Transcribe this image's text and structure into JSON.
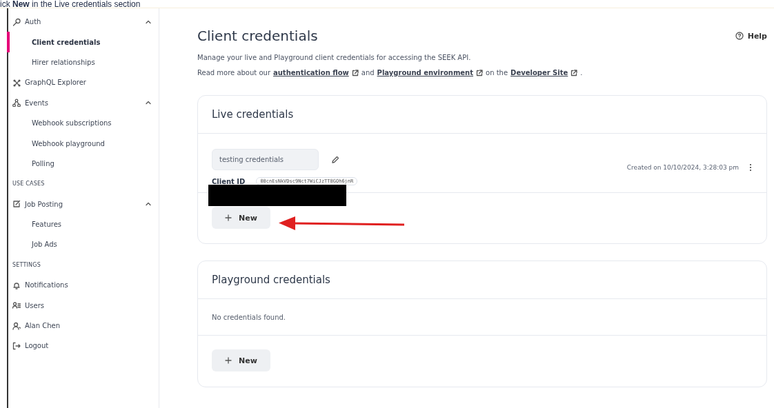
{
  "caption": "ick **New** in the Live credentials section",
  "sidebar": {
    "items": [
      {
        "kind": "group",
        "label": "Auth",
        "expanded": true,
        "children": [
          {
            "label": "Client credentials",
            "selected": true
          },
          {
            "label": "Hirer relationships",
            "selected": false
          }
        ]
      },
      {
        "kind": "link",
        "label": "GraphQL Explorer"
      },
      {
        "kind": "group",
        "label": "Events",
        "expanded": true,
        "children": [
          {
            "label": "Webhook subscriptions",
            "selected": false
          },
          {
            "label": "Webhook playground",
            "selected": false
          },
          {
            "label": "Polling",
            "selected": false
          }
        ]
      },
      {
        "kind": "heading",
        "label": "USE CASES"
      },
      {
        "kind": "group",
        "label": "Job Posting",
        "expanded": true,
        "children": [
          {
            "label": "Features",
            "selected": false
          },
          {
            "label": "Job Ads",
            "selected": false
          }
        ]
      },
      {
        "kind": "heading",
        "label": "SETTINGS"
      },
      {
        "kind": "link",
        "label": "Notifications"
      },
      {
        "kind": "link",
        "label": "Users"
      },
      {
        "kind": "link",
        "label": "Alan Chen"
      },
      {
        "kind": "link",
        "label": "Logout"
      }
    ]
  },
  "page": {
    "title": "Client credentials",
    "help": "Help",
    "description": "Manage your live and Playground client credentials for accessing the SEEK API.",
    "links_line": [
      {
        "kind": "text",
        "text": "Read more about our"
      },
      {
        "kind": "link",
        "text": "authentication flow"
      },
      {
        "kind": "text",
        "text": "and"
      },
      {
        "kind": "link",
        "text": "Playground environment"
      },
      {
        "kind": "text",
        "text": "on the"
      },
      {
        "kind": "link",
        "text": "Developer Site"
      },
      {
        "kind": "text",
        "text": "."
      }
    ]
  },
  "sections": [
    {
      "title": "Live credentials",
      "credentials": [
        {
          "name": "testing credentials",
          "client_id_label": "Client ID",
          "client_id": "08cnEsNkVDsc9Nct7WiCJzTT8GOh6jnR",
          "created": "Created on 10/10/2024, 3:28:03 pm"
        }
      ],
      "new_button": "New",
      "arrow": true
    },
    {
      "title": "Playground credentials",
      "empty_text": "No credentials found.",
      "new_button": "New"
    }
  ]
}
